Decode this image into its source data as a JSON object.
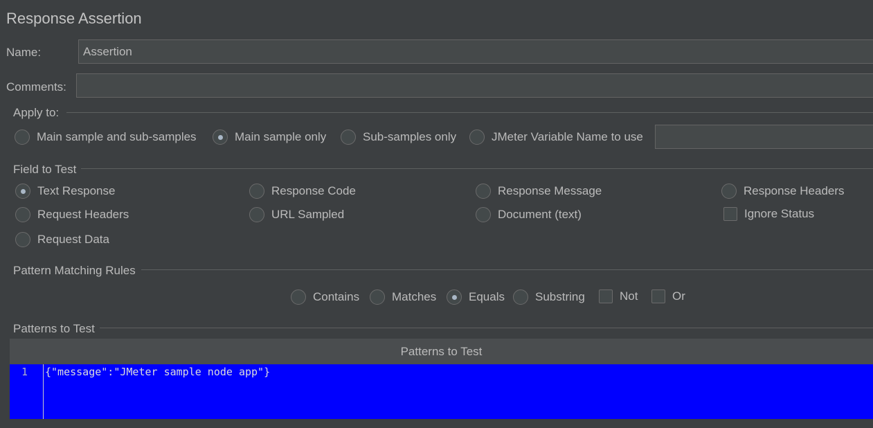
{
  "panel": {
    "title": "Response Assertion"
  },
  "name_field": {
    "label": "Name:",
    "value": "Assertion"
  },
  "comments_field": {
    "label": "Comments:",
    "value": ""
  },
  "apply_to": {
    "title": "Apply to:",
    "options": [
      {
        "label": "Main sample and sub-samples",
        "checked": false
      },
      {
        "label": "Main sample only",
        "checked": true
      },
      {
        "label": "Sub-samples only",
        "checked": false
      },
      {
        "label": "JMeter Variable Name to use",
        "checked": false
      }
    ],
    "variable_value": ""
  },
  "field_to_test": {
    "title": "Field to Test",
    "options": [
      {
        "label": "Text Response",
        "checked": true
      },
      {
        "label": "Response Code",
        "checked": false
      },
      {
        "label": "Response Message",
        "checked": false
      },
      {
        "label": "Response Headers",
        "checked": false
      },
      {
        "label": "Request Headers",
        "checked": false
      },
      {
        "label": "URL Sampled",
        "checked": false
      },
      {
        "label": "Document (text)",
        "checked": false
      },
      {
        "label": "Ignore Status",
        "checked": false
      },
      {
        "label": "Request Data",
        "checked": false
      }
    ]
  },
  "pattern_rules": {
    "title": "Pattern Matching Rules",
    "options": [
      {
        "label": "Contains",
        "checked": false
      },
      {
        "label": "Matches",
        "checked": false
      },
      {
        "label": "Equals",
        "checked": true
      },
      {
        "label": "Substring",
        "checked": false
      },
      {
        "label": "Not",
        "checked": false
      },
      {
        "label": "Or",
        "checked": false
      }
    ]
  },
  "patterns": {
    "title": "Patterns to Test",
    "column_header": "Patterns to Test",
    "lines": [
      {
        "number": "1",
        "text": "{\"message\":\"JMeter sample node app\"}"
      }
    ]
  },
  "colors": {
    "background": "#3c3f41",
    "editor_selection": "#0000ff"
  }
}
